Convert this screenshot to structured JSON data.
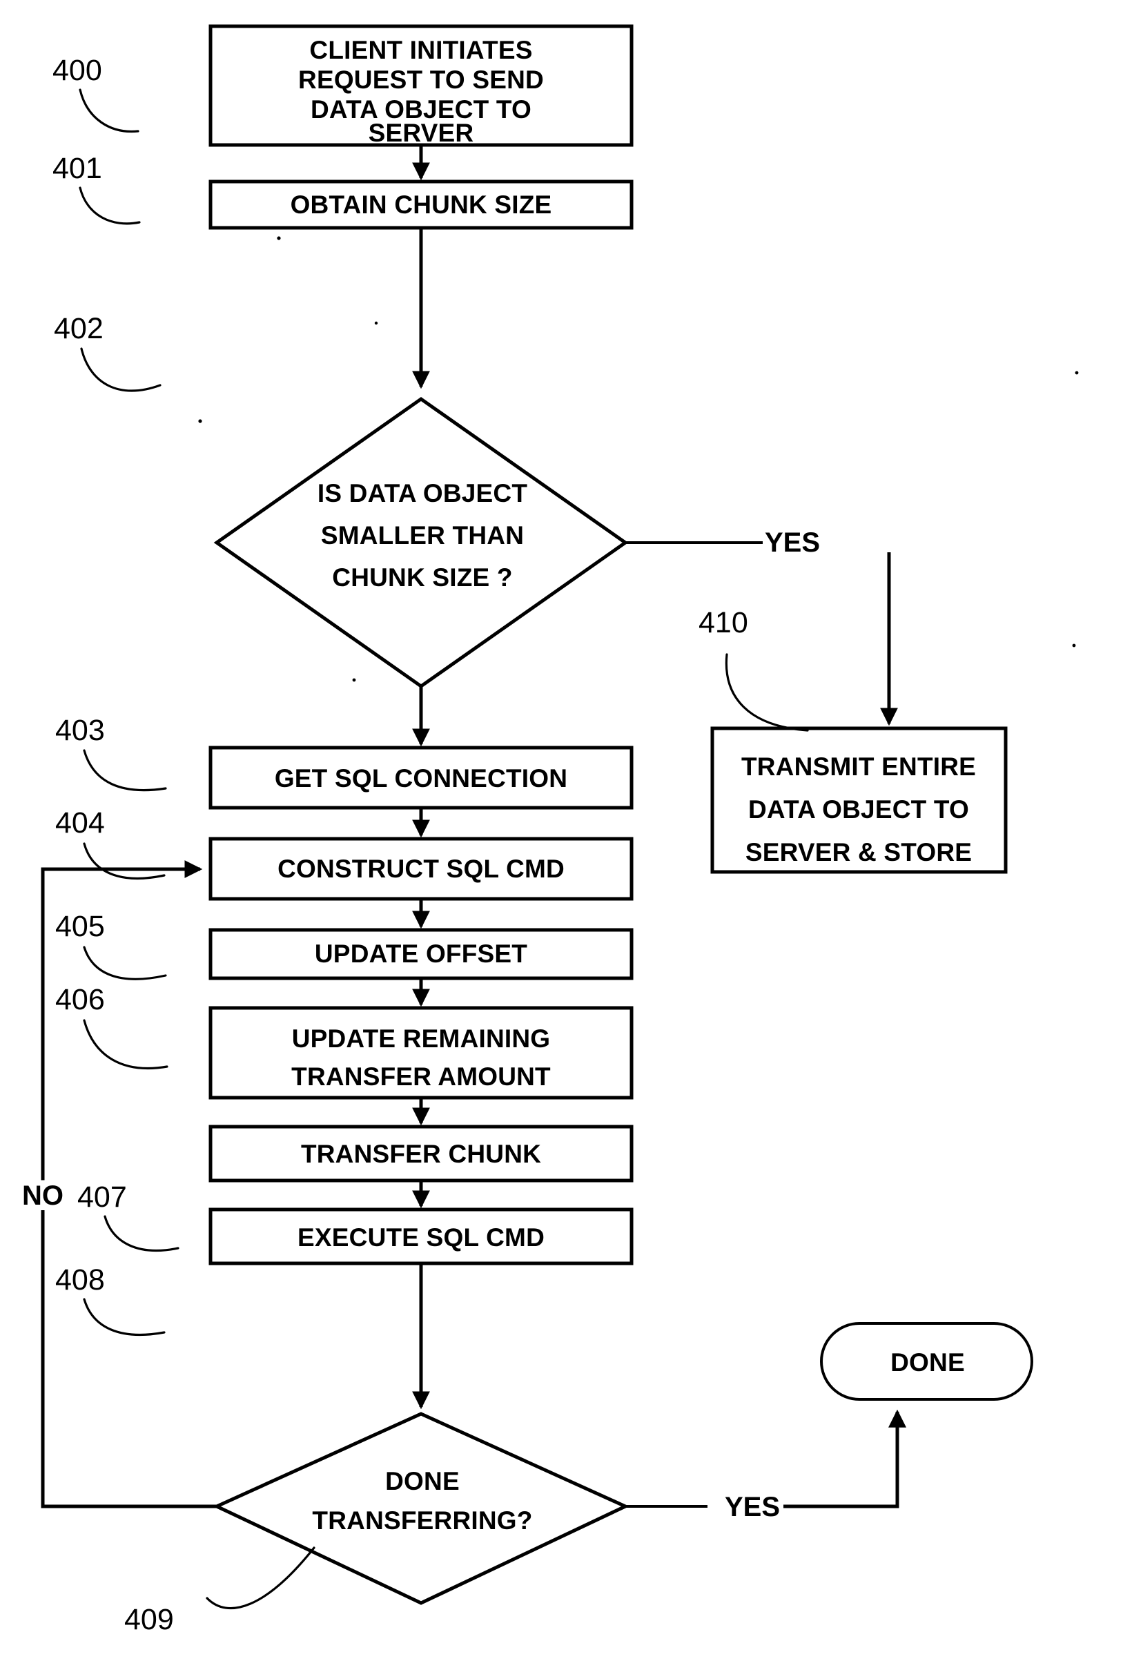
{
  "figure": {
    "type": "patent-flowchart",
    "ink_color": "#000000",
    "background_color": "#ffffff"
  },
  "nodes": [
    {
      "ref": "400",
      "shape": "process",
      "lines": [
        "CLIENT INITIATES",
        "REQUEST TO SEND",
        "DATA OBJECT TO",
        "SERVER"
      ],
      "line1": "CLIENT INITIATES",
      "line2": "REQUEST TO SEND",
      "line3": "DATA OBJECT TO",
      "line4": "SERVER"
    },
    {
      "ref": "401",
      "shape": "process",
      "line1": "OBTAIN CHUNK SIZE"
    },
    {
      "ref": "402",
      "shape": "decision",
      "line1": "IS DATA OBJECT",
      "line2": "SMALLER THAN",
      "line3": "CHUNK SIZE ?"
    },
    {
      "ref": "403",
      "shape": "process",
      "line1": "GET SQL CONNECTION"
    },
    {
      "ref": "404",
      "shape": "process",
      "line1": "CONSTRUCT SQL CMD"
    },
    {
      "ref": "405",
      "shape": "process",
      "line1": "UPDATE OFFSET"
    },
    {
      "ref": "406",
      "shape": "process",
      "line1": "UPDATE REMAINING",
      "line2": "TRANSFER AMOUNT"
    },
    {
      "ref": "407",
      "shape": "process",
      "line1": "TRANSFER CHUNK"
    },
    {
      "ref": "408",
      "shape": "process",
      "line1": "EXECUTE SQL CMD"
    },
    {
      "ref": "409",
      "shape": "decision",
      "line1": "DONE",
      "line2": "TRANSFERRING?"
    },
    {
      "ref": "410",
      "shape": "process",
      "line1": "TRANSMIT ENTIRE",
      "line2": "DATA OBJECT TO",
      "line3": "SERVER & STORE"
    },
    {
      "ref": "",
      "shape": "terminator",
      "line1": "DONE"
    }
  ],
  "edge_labels": {
    "decision_402_yes": "YES",
    "decision_409_yes": "YES",
    "decision_409_no": "NO"
  },
  "reference_numerals": {
    "n400": "400",
    "n401": "401",
    "n402": "402",
    "n403": "403",
    "n404": "404",
    "n405": "405",
    "n406": "406",
    "n407": "407",
    "n408": "408",
    "n409": "409",
    "n410": "410"
  },
  "text": {
    "box400_l1": "CLIENT INITIATES",
    "box400_l2": "REQUEST TO SEND",
    "box400_l3": "DATA OBJECT TO",
    "box400_l4": "SERVER",
    "box401_l1": "OBTAIN CHUNK SIZE",
    "dia402_l1": "IS DATA OBJECT",
    "dia402_l2": "SMALLER THAN",
    "dia402_l3": "CHUNK SIZE ?",
    "box403_l1": "GET SQL CONNECTION",
    "box404_l1": "CONSTRUCT SQL CMD",
    "box405_l1": "UPDATE OFFSET",
    "box406_l1": "UPDATE REMAINING",
    "box406_l2": "TRANSFER AMOUNT",
    "box407_l1": "TRANSFER CHUNK",
    "box408_l1": "EXECUTE SQL CMD",
    "dia409_l1": "DONE",
    "dia409_l2": "TRANSFERRING?",
    "box410_l1": "TRANSMIT ENTIRE",
    "box410_l2": "DATA OBJECT TO",
    "box410_l3": "SERVER & STORE",
    "term_done": "DONE",
    "yes_top": "YES",
    "yes_bottom": "YES",
    "no_left": "NO"
  }
}
